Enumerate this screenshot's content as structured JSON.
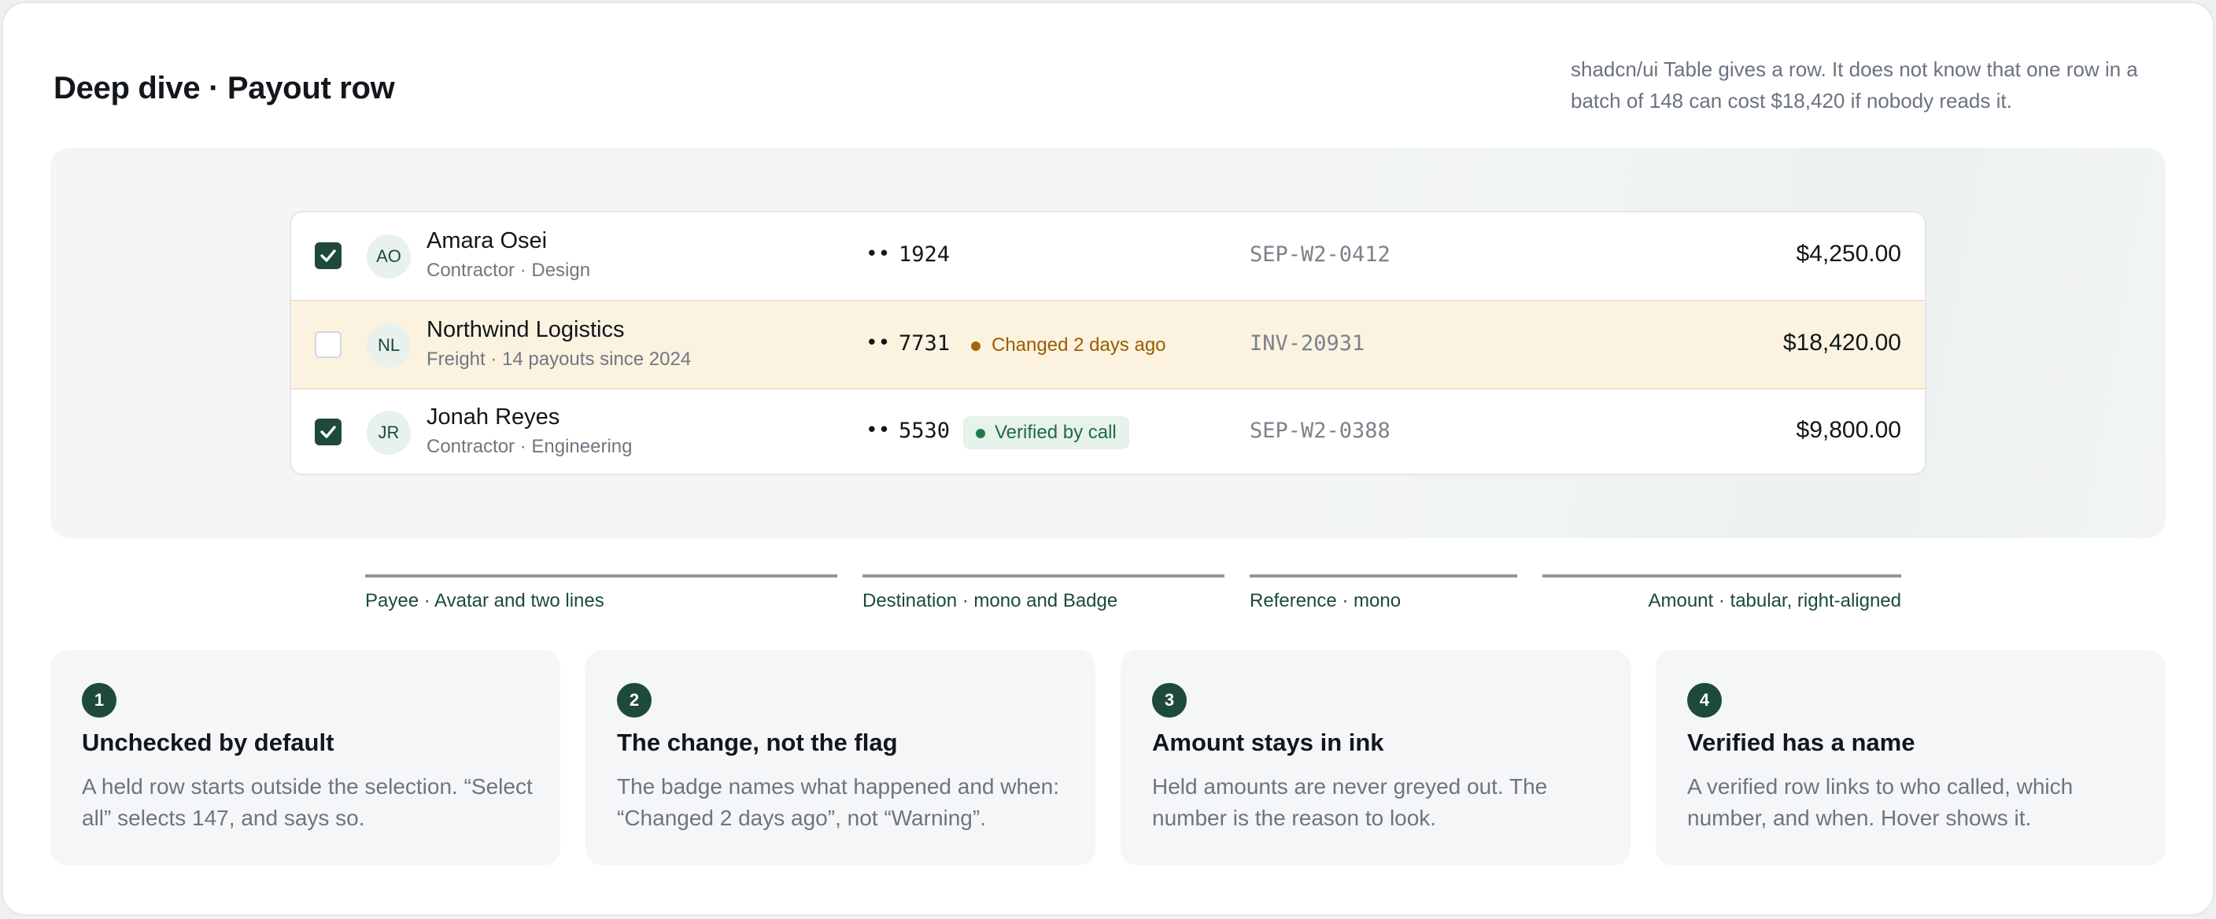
{
  "header": {
    "title": "Deep dive · Payout row",
    "blurb": "shadcn/ui Table gives a row. It does not know that one row in a batch of 148 can cost $18,420 if nobody reads it."
  },
  "rows": [
    {
      "checked": true,
      "initials": "AO",
      "name": "Amara Osei",
      "sub": "Contractor · Design",
      "dots": "••",
      "account": "1924",
      "badge": "",
      "reference": "SEP-W2-0412",
      "amount": "$4,250.00"
    },
    {
      "checked": false,
      "initials": "NL",
      "name": "Northwind Logistics",
      "sub": "Freight · 14 payouts since 2024",
      "dots": "••",
      "account": "7731",
      "badge": "Changed 2 days ago",
      "reference": "INV-20931",
      "amount": "$18,420.00"
    },
    {
      "checked": true,
      "initials": "JR",
      "name": "Jonah Reyes",
      "sub": "Contractor · Engineering",
      "dots": "••",
      "account": "5530",
      "badge": "Verified by call",
      "reference": "SEP-W2-0388",
      "amount": "$9,800.00"
    }
  ],
  "columns": [
    {
      "label": "Payee · Avatar and two lines"
    },
    {
      "label": "Destination · mono and Badge"
    },
    {
      "label": "Reference · mono"
    },
    {
      "label": "Amount · tabular, right-aligned"
    }
  ],
  "cards": [
    {
      "num": "1",
      "title": "Unchecked by default",
      "body": "A held row starts outside the selection. “Select all” selects 147, and says so."
    },
    {
      "num": "2",
      "title": "The change, not the flag",
      "body": "The badge names what happened and when: “Changed 2 days ago”, not “Warning”."
    },
    {
      "num": "3",
      "title": "Amount stays in ink",
      "body": "Held amounts are never greyed out. The number is the reason to look."
    },
    {
      "num": "4",
      "title": "Verified has a name",
      "body": "A verified row links to who called, which number, and when. Hover shows it."
    }
  ],
  "colors": {
    "accent": "#1d4a3b",
    "warn": "#a86508",
    "ok": "#1f7a4a",
    "held_row": "#fbf3e0"
  }
}
